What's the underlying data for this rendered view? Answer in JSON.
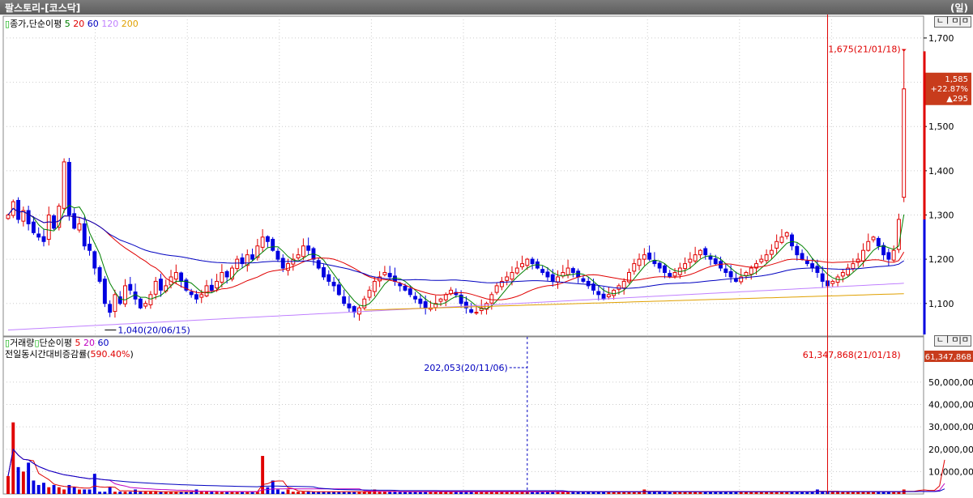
{
  "window": {
    "title": "팔스토리-[코스닥]",
    "period": "(일)"
  },
  "price_panel": {
    "legend_label": "종가,단순이평",
    "ma_periods": [
      "5",
      "20",
      "60",
      "120",
      "200"
    ],
    "ma_colors": [
      "#008000",
      "#e00000",
      "#0000c0",
      "#c080ff",
      "#e0a000"
    ],
    "panel_buttons": "ㄴㅣㅁ|ㅁ",
    "high_annotation": "1,675(21/01/18)",
    "low_annotation": "1,040(20/06/15)",
    "current_price": "1,585",
    "change_rate": "+22.87%",
    "change_amount": "▲295",
    "y_ticks": [
      "1,700",
      "1,600",
      "1,500",
      "1,400",
      "1,300",
      "1,200",
      "1,100"
    ]
  },
  "volume_panel": {
    "legend_label": "거래량",
    "legend_label2": "단순이평",
    "ma_periods": [
      "5",
      "20",
      "60"
    ],
    "ma_colors": [
      "#e00000",
      "#c000c0",
      "#0000c0"
    ],
    "sub_label": "전일동시간대비증감률(",
    "sub_value": "590.40%",
    "sub_close": ")",
    "panel_buttons": "ㄴㅣㅁ|ㅁ",
    "max_annotation": "61,347,868(21/01/18)",
    "mark_annotation": "202,053(20/11/06)",
    "current_volume": "61,347,868",
    "y_ticks": [
      "50,000,000",
      "40,000,000",
      "30,000,000",
      "20,000,000",
      "10,000,000"
    ]
  },
  "chart_data": {
    "type": "candlestick",
    "price_ylim": [
      1030,
      1720
    ],
    "volume_ylim": [
      0,
      63000000
    ],
    "last_candle": {
      "date": "21/01/18",
      "open": 1340,
      "high": 1675,
      "close": 1585
    },
    "closes": [
      1300,
      1330,
      1290,
      1310,
      1280,
      1260,
      1250,
      1240,
      1300,
      1270,
      1320,
      1420,
      1300,
      1270,
      1280,
      1230,
      1220,
      1180,
      1150,
      1100,
      1080,
      1120,
      1100,
      1140,
      1130,
      1110,
      1090,
      1100,
      1120,
      1150,
      1130,
      1140,
      1160,
      1170,
      1150,
      1130,
      1120,
      1110,
      1120,
      1140,
      1130,
      1150,
      1170,
      1160,
      1180,
      1200,
      1190,
      1210,
      1200,
      1230,
      1250,
      1240,
      1220,
      1200,
      1180,
      1190,
      1200,
      1210,
      1230,
      1220,
      1200,
      1180,
      1160,
      1150,
      1140,
      1120,
      1100,
      1090,
      1080,
      1090,
      1110,
      1130,
      1150,
      1160,
      1170,
      1160,
      1150,
      1140,
      1130,
      1120,
      1110,
      1100,
      1090,
      1090,
      1100,
      1110,
      1120,
      1130,
      1120,
      1100,
      1090,
      1080,
      1080,
      1090,
      1100,
      1120,
      1140,
      1150,
      1160,
      1170,
      1180,
      1190,
      1200,
      1190,
      1180,
      1170,
      1160,
      1150,
      1160,
      1170,
      1180,
      1170,
      1160,
      1150,
      1140,
      1130,
      1120,
      1110,
      1120,
      1130,
      1140,
      1150,
      1170,
      1190,
      1200,
      1210,
      1200,
      1190,
      1180,
      1170,
      1160,
      1170,
      1180,
      1190,
      1200,
      1210,
      1220,
      1210,
      1200,
      1190,
      1180,
      1170,
      1160,
      1150,
      1160,
      1170,
      1180,
      1190,
      1200,
      1210,
      1220,
      1240,
      1250,
      1260,
      1230,
      1210,
      1200,
      1190,
      1180,
      1170,
      1150,
      1140,
      1150,
      1160,
      1170,
      1180,
      1190,
      1200,
      1220,
      1240,
      1250,
      1230,
      1210,
      1200,
      1220,
      1290,
      1585
    ],
    "volumes": [
      8,
      32,
      12,
      10,
      14,
      6,
      4,
      5,
      3,
      4,
      3,
      2,
      4,
      3,
      2,
      2,
      2,
      9,
      1,
      1,
      3,
      1,
      1,
      1,
      1,
      2,
      1,
      1,
      1,
      1,
      1,
      1,
      1,
      1,
      1,
      1,
      1,
      2,
      1,
      1,
      1,
      1,
      1,
      1,
      1,
      1,
      1,
      1,
      1,
      1,
      17,
      3,
      6,
      2,
      1,
      2,
      1,
      1,
      1,
      1,
      1,
      1,
      1,
      1,
      1,
      1,
      1,
      1,
      1,
      1,
      1,
      1,
      2,
      1,
      1,
      1,
      1,
      1,
      1,
      1,
      1,
      1,
      1,
      1,
      1,
      1,
      1,
      1,
      1,
      1,
      1,
      1,
      1,
      1,
      1,
      1,
      1,
      1,
      1,
      1,
      1,
      1,
      1,
      1,
      1,
      1,
      1,
      1,
      1,
      1,
      1,
      1,
      1,
      1,
      1,
      1,
      1,
      1,
      1,
      1,
      1,
      1,
      1,
      1,
      1,
      2,
      1,
      1,
      1,
      1,
      1,
      1,
      1,
      1,
      1,
      1,
      1,
      1,
      1,
      1,
      1,
      1,
      1,
      1,
      1,
      1,
      1,
      1,
      1,
      1,
      1,
      1,
      1,
      1,
      1,
      1,
      1,
      1,
      1,
      2,
      1,
      1,
      1,
      1,
      1,
      1,
      1,
      1,
      1,
      1,
      1,
      1,
      1,
      1,
      1,
      1,
      2,
      1,
      1,
      3,
      2,
      1,
      1,
      11,
      61.3
    ]
  }
}
